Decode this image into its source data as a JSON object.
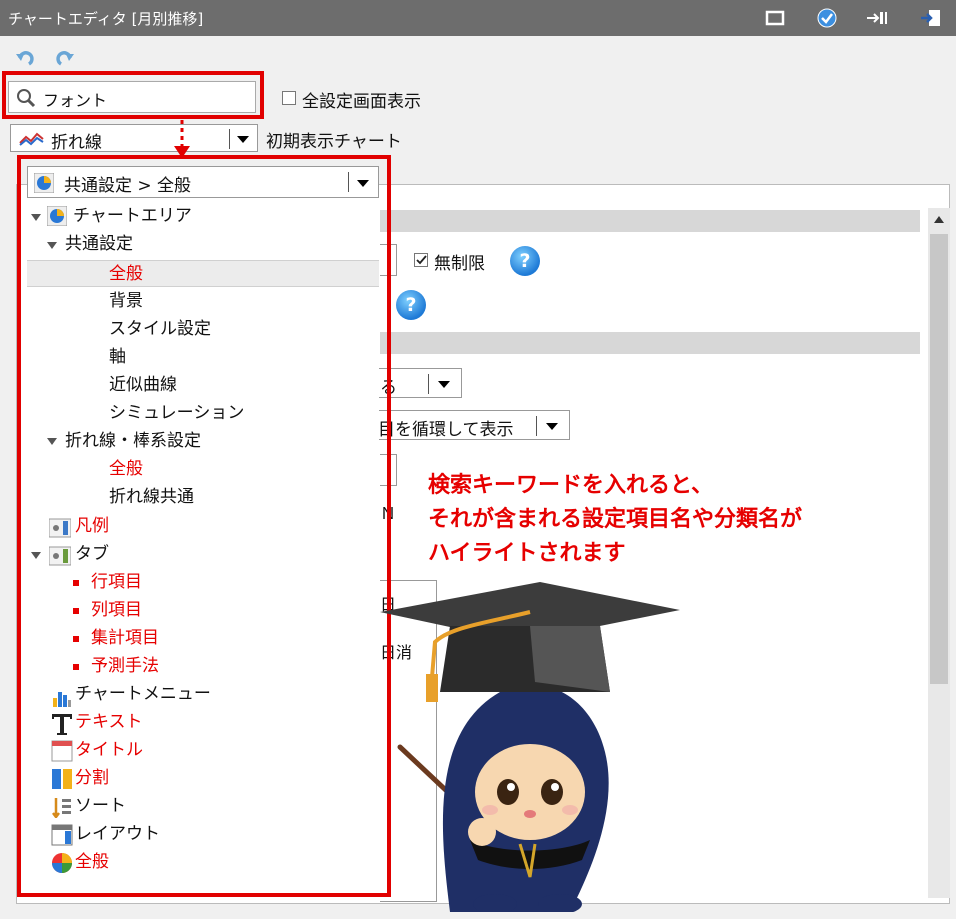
{
  "window": {
    "title": "チャートエディタ [月別推移]"
  },
  "search": {
    "value": "フォント"
  },
  "show_all_settings": {
    "label": "全設定画面表示",
    "checked": false
  },
  "chart_type": {
    "value": "折れ線",
    "label": "初期表示チャート"
  },
  "category_dropdown": {
    "value": "共通設定 > 全般"
  },
  "tree": [
    {
      "label": "チャートエリア"
    },
    {
      "label": "共通設定"
    },
    {
      "label": "全般"
    },
    {
      "label": "背景"
    },
    {
      "label": "スタイル設定"
    },
    {
      "label": "軸"
    },
    {
      "label": "近似曲線"
    },
    {
      "label": "シミュレーション"
    },
    {
      "label": "折れ線・棒系設定"
    },
    {
      "label": "全般"
    },
    {
      "label": "折れ線共通"
    },
    {
      "label": "凡例"
    },
    {
      "label": "タブ"
    },
    {
      "label": "行項目"
    },
    {
      "label": "列項目"
    },
    {
      "label": "集計項目"
    },
    {
      "label": "予測手法"
    },
    {
      "label": "チャートメニュー"
    },
    {
      "label": "テキスト"
    },
    {
      "label": "タイトル"
    },
    {
      "label": "分割"
    },
    {
      "label": "ソート"
    },
    {
      "label": "レイアウト"
    },
    {
      "label": "全般"
    }
  ],
  "settings": {
    "unlimited_label": "無制限",
    "unlimited_checked": true,
    "partial_1": "る",
    "partial_2": "目を循環して表示",
    "partial_3": "Ｎ",
    "partial_4": "日",
    "partial_5": "日消",
    "help": "?"
  },
  "annotation": {
    "line1": "検索キーワードを入れると、",
    "line2": "それが含まれる設定項目名や分類名が",
    "line3": "ハイライトされます"
  },
  "colors": {
    "highlight": "#e60000",
    "titlebar": "#6d6d6d",
    "help": "#1e7ad6"
  }
}
